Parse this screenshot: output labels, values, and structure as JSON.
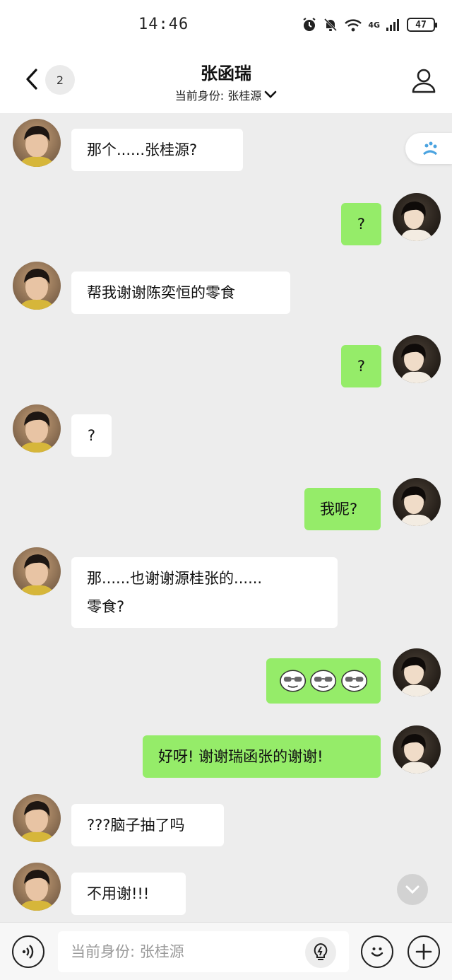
{
  "status": {
    "time": "14:46",
    "network": "4G",
    "battery": "47"
  },
  "header": {
    "title": "张函瑞",
    "subtitle": "当前身份: 张桂源",
    "unread": "2"
  },
  "messages": [
    {
      "side": "in",
      "text": "那个......张桂源?"
    },
    {
      "side": "out",
      "text": "?"
    },
    {
      "side": "in",
      "text": "帮我谢谢陈奕恒的零食"
    },
    {
      "side": "out",
      "text": "?"
    },
    {
      "side": "in",
      "text": "?"
    },
    {
      "side": "out",
      "text": "我呢?"
    },
    {
      "side": "in",
      "text": "那......也谢谢源桂张的......",
      "text2": "零食?"
    },
    {
      "side": "out",
      "type": "emoji",
      "emoji_name": "sunglasses-emoji",
      "count": 3
    },
    {
      "side": "out",
      "text": "好呀! 谢谢瑞函张的谢谢!"
    },
    {
      "side": "in",
      "text": "???脑子抽了吗"
    },
    {
      "side": "in",
      "text": "不用谢!!!"
    }
  ],
  "input": {
    "placeholder": "当前身份: 张桂源"
  },
  "icons": {
    "back": "chevron-left-icon",
    "profile": "person-icon",
    "voice": "voice-icon",
    "emoji": "smile-icon",
    "plus": "plus-icon",
    "scroll": "chevron-down-icon"
  },
  "colors": {
    "outgoing_bubble": "#95ec69",
    "incoming_bubble": "#ffffff",
    "background": "#ededed"
  }
}
